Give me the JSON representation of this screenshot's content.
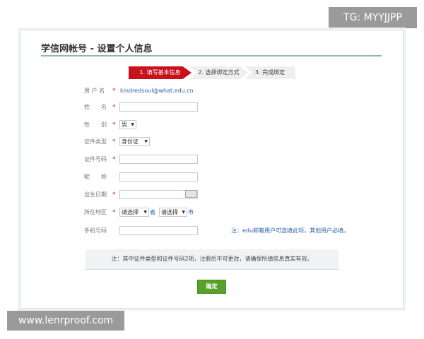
{
  "watermarks": {
    "top_right": "TG: MYYJJPP",
    "bottom_left": "www.lenrproof.com"
  },
  "page_title": "学信网帐号 - 设置个人信息",
  "steps": [
    "1. 填写基本信息",
    "2. 选择绑定方式",
    "3. 完成绑定"
  ],
  "form": {
    "username": {
      "label": "用 户 名",
      "value": "kindredsoul@what.edu.cn",
      "required": true
    },
    "name": {
      "label": "姓　　名",
      "value": "",
      "required": true
    },
    "gender": {
      "label": "性　　别",
      "value": "男",
      "required": true
    },
    "id_type": {
      "label": "证件类型",
      "value": "身份证",
      "required": true
    },
    "id_number": {
      "label": "证件号码",
      "value": "",
      "required": true
    },
    "nickname": {
      "label": "昵　　称",
      "value": "",
      "required": false
    },
    "birthday": {
      "label": "出生日期",
      "value": "",
      "required": true
    },
    "region": {
      "label": "所在地区",
      "required": true,
      "province_placeholder": "请选择",
      "province_unit": "省",
      "city_placeholder": "请选择",
      "city_unit": "市"
    },
    "mobile": {
      "label": "手机号码",
      "value": "",
      "required": false,
      "note": "注：edu邮箱用户可选填此项，其他用户必填。"
    }
  },
  "notice": "注：其中证件类型和证件号码2项，注册后不可更改，请确保所填信息真实有效。",
  "submit_label": "确定",
  "colors": {
    "accent": "#c8111b",
    "link": "#2b64a8",
    "submit": "#5aa12c"
  }
}
